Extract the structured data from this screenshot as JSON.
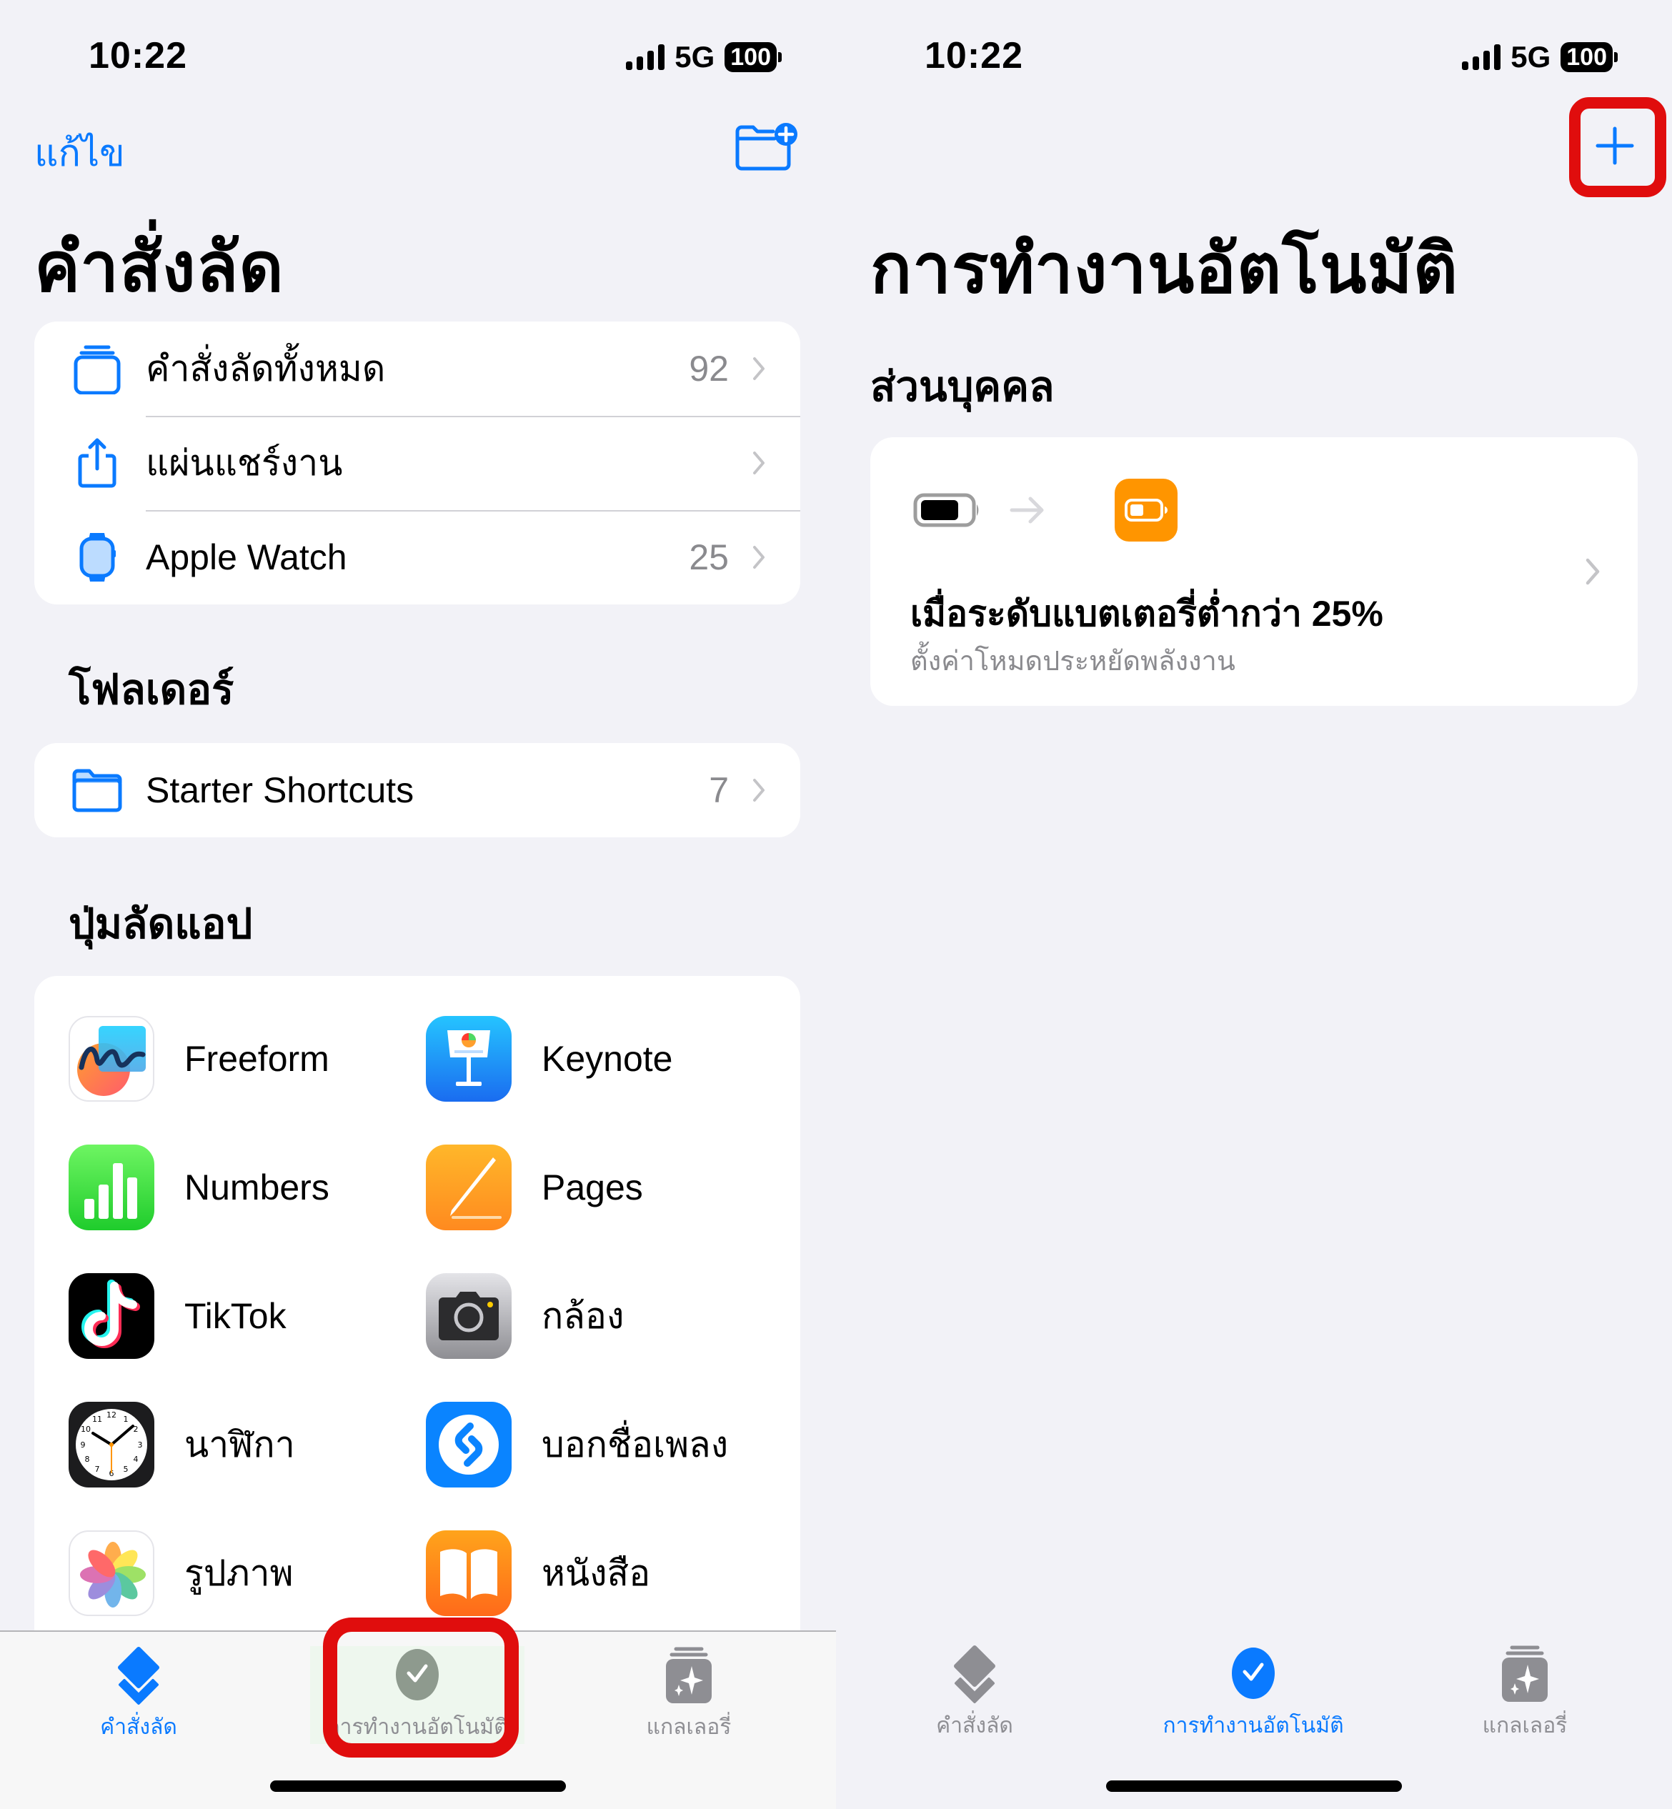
{
  "left": {
    "status": {
      "time": "10:22",
      "network": "5G",
      "battery": "100"
    },
    "nav": {
      "edit_label": "แก้ไข",
      "new_folder_icon": "folder-badge-plus-icon"
    },
    "title": "คำสั่งลัด",
    "main_list": [
      {
        "label": "คำสั่งลัดทั้งหมด",
        "count": "92",
        "icon": "stack-icon"
      },
      {
        "label": "แผ่นแชร์งาน",
        "count": "",
        "icon": "share-icon"
      },
      {
        "label": "Apple Watch",
        "count": "25",
        "icon": "apple-watch-icon"
      }
    ],
    "folders_heading": "โฟลเดอร์",
    "folders": [
      {
        "label": "Starter Shortcuts",
        "count": "7",
        "icon": "folder-icon"
      }
    ],
    "app_shortcuts_heading": "ปุ่มลัดแอป",
    "apps": [
      {
        "label": "Freeform",
        "icon": "freeform-app-icon"
      },
      {
        "label": "Keynote",
        "icon": "keynote-app-icon"
      },
      {
        "label": "Numbers",
        "icon": "numbers-app-icon"
      },
      {
        "label": "Pages",
        "icon": "pages-app-icon"
      },
      {
        "label": "TikTok",
        "icon": "tiktok-app-icon"
      },
      {
        "label": "กล้อง",
        "icon": "camera-app-icon"
      },
      {
        "label": "นาฬิกา",
        "icon": "clock-app-icon"
      },
      {
        "label": "บอกชื่อเพลง",
        "icon": "shazam-app-icon"
      },
      {
        "label": "รูปภาพ",
        "icon": "photos-app-icon"
      },
      {
        "label": "หนังสือ",
        "icon": "books-app-icon"
      }
    ],
    "tabs": [
      {
        "label": "คำสั่งลัด",
        "active": true
      },
      {
        "label": "การทำงานอัตโนมัติ",
        "active": false,
        "highlighted": true
      },
      {
        "label": "แกลเลอรี่",
        "active": false
      }
    ]
  },
  "right": {
    "status": {
      "time": "10:22",
      "network": "5G",
      "battery": "100"
    },
    "nav": {
      "add_icon": "plus-icon",
      "add_highlighted": true
    },
    "title": "การทำงานอัตโนมัติ",
    "section_heading": "ส่วนบุคคล",
    "automations": [
      {
        "title": "เมื่อระดับแบตเตอรี่ต่ำกว่า 25%",
        "subtitle": "ตั้งค่าโหมดประหยัดพลังงาน",
        "trigger_icon": "battery-icon",
        "action_icon": "low-power-battery-icon",
        "battery_threshold_percent": 25
      }
    ],
    "tabs": [
      {
        "label": "คำสั่งลัด",
        "active": false
      },
      {
        "label": "การทำงานอัตโนมัติ",
        "active": true
      },
      {
        "label": "แกลเลอรี่",
        "active": false
      }
    ]
  },
  "colors": {
    "accent": "#0a7aff",
    "background": "#f2f2f7",
    "card": "#ffffff",
    "secondary_text": "#8a8a8e",
    "highlight_box": "#e00d0d",
    "low_power_orange": "#ff9500"
  }
}
